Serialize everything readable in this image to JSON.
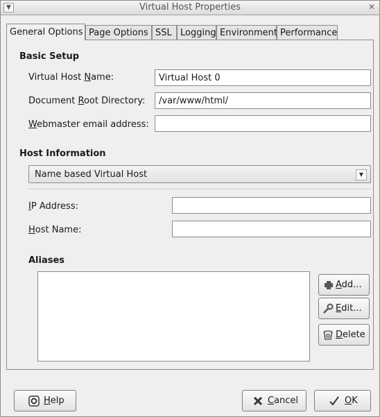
{
  "window": {
    "title": "Virtual Host Properties"
  },
  "tabs": [
    {
      "label": "General Options",
      "active": true
    },
    {
      "label": "Page Options"
    },
    {
      "label": "SSL"
    },
    {
      "label": "Logging"
    },
    {
      "label": "Environment"
    },
    {
      "label": "Performance"
    }
  ],
  "basic_setup": {
    "heading": "Basic Setup",
    "name_label_pre": "Virtual Host ",
    "name_label_mn": "N",
    "name_label_post": "ame:",
    "name_value": "Virtual Host 0",
    "docroot_label_pre": "Document ",
    "docroot_label_mn": "R",
    "docroot_label_post": "oot Directory:",
    "docroot_value": "/var/www/html/",
    "email_label_mn": "W",
    "email_label_post": "ebmaster email address:",
    "email_value": ""
  },
  "host_info": {
    "heading": "Host Information",
    "type_selected": "Name based Virtual Host",
    "ip_label_mn": "I",
    "ip_label_post": "P Address:",
    "ip_value": "",
    "hostname_label_mn": "H",
    "hostname_label_post": "ost Name:",
    "hostname_value": ""
  },
  "aliases": {
    "heading": "Aliases",
    "add_mn": "A",
    "add_post": "dd...",
    "edit_mn": "E",
    "edit_post": "dit...",
    "delete_mn": "D",
    "delete_post": "elete"
  },
  "footer": {
    "help_mn": "H",
    "help_post": "elp",
    "cancel_mn": "C",
    "cancel_post": "ancel",
    "ok_mn": "O",
    "ok_post": "K"
  }
}
